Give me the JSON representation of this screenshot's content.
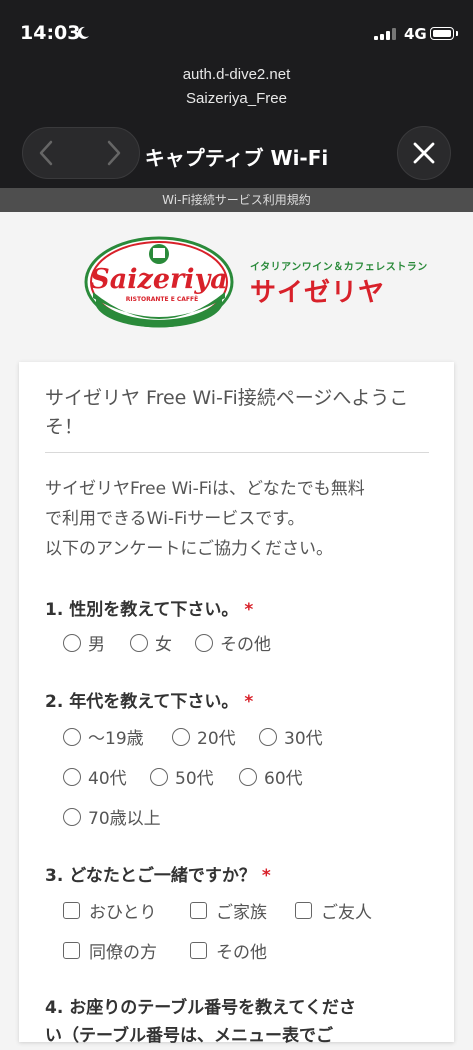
{
  "status": {
    "time": "14:03",
    "network": "4G"
  },
  "browser": {
    "domain": "auth.d-dive2.net",
    "ssid": "Saizeriya_Free",
    "title": "キャプティブ Wi-Fi",
    "subtitle": "Wi-Fi接続サービス利用規約"
  },
  "brand": {
    "logo_text": "Saizeriya",
    "logo_subtext": "RISTORANTE E CAFFÈ",
    "tagline_small": "イタリアンワイン＆カフェレストラン",
    "tagline_big": "サイゼリヤ",
    "colors": {
      "red": "#d8212a",
      "green": "#2a8a3a"
    }
  },
  "form": {
    "welcome": "サイゼリヤ Free Wi-Fi接続ページへようこそ！",
    "intro_1": "サイゼリヤFree Wi-Fiは、どなたでも無料",
    "intro_2": "で利用できるWi-Fiサービスです。",
    "intro_3": "以下のアンケートにご協力ください。",
    "required_mark": "*",
    "questions": [
      {
        "label": "1. 性別を教えて下さい。",
        "options": [
          "男",
          "女",
          "その他"
        ]
      },
      {
        "label": "2. 年代を教えて下さい。",
        "options": [
          "〜19歳",
          "20代",
          "30代",
          "40代",
          "50代",
          "60代",
          "70歳以上"
        ]
      },
      {
        "label": "3. どなたとご一緒ですか？",
        "options": [
          "おひとり",
          "ご家族",
          "ご友人",
          "同僚の方",
          "その他"
        ]
      },
      {
        "label": "4. お座りのテーブル番号を教えてくださ",
        "label_2": "い（テーブル番号は、メニュー表でご"
      }
    ]
  }
}
